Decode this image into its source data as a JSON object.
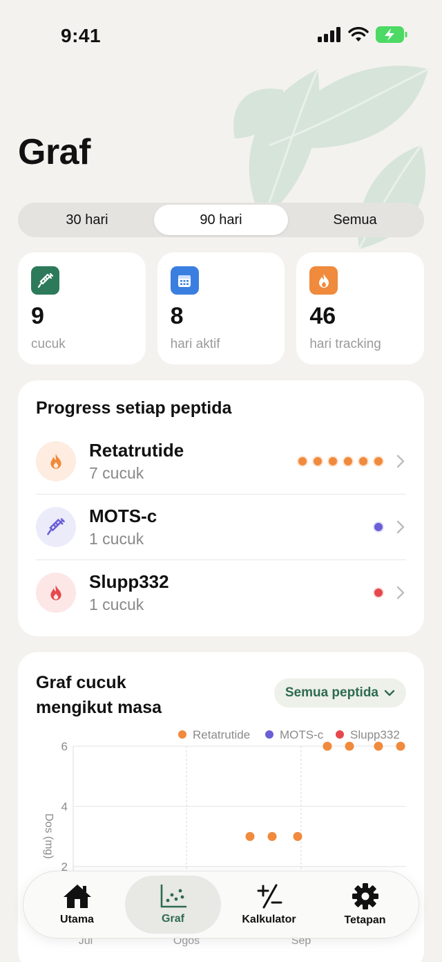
{
  "status_bar": {
    "time": "9:41"
  },
  "page": {
    "title": "Graf"
  },
  "range_tabs": [
    {
      "label": "30 hari",
      "active": false
    },
    {
      "label": "90 hari",
      "active": true
    },
    {
      "label": "Semua",
      "active": false
    }
  ],
  "stats": [
    {
      "value": "9",
      "label": "cucuk",
      "icon": "syringe-icon",
      "color": "#2d7a5a"
    },
    {
      "value": "8",
      "label": "hari aktif",
      "icon": "calendar-icon",
      "color": "#3a7fe0"
    },
    {
      "value": "46",
      "label": "hari tracking",
      "icon": "flame-icon",
      "color": "#f08a3c"
    }
  ],
  "progress": {
    "title": "Progress setiap peptida",
    "items": [
      {
        "name": "Retatrutide",
        "count": "7 cucuk",
        "icon": "flame-icon",
        "color": "#f08a3c",
        "avatar_bg": "#fdecdf",
        "dots": 6
      },
      {
        "name": "MOTS-c",
        "count": "1 cucuk",
        "icon": "syringe-icon",
        "color": "#6b5fd6",
        "avatar_bg": "#ecebfa",
        "dots": 1
      },
      {
        "name": "Slupp332",
        "count": "1 cucuk",
        "icon": "flame-icon",
        "color": "#e5484d",
        "avatar_bg": "#fde6e6",
        "dots": 1
      }
    ]
  },
  "chart_section": {
    "title": "Graf cucuk mengikut masa",
    "filter_label": "Semua peptida"
  },
  "chart_data": {
    "type": "scatter",
    "ylabel": "Dos (mg)",
    "xlabel": "",
    "y_ticks": [
      "6",
      "4",
      "2"
    ],
    "x_ticks": [
      "Jul",
      "Ogos",
      "Sep"
    ],
    "ylim": [
      2,
      6
    ],
    "legend_position": "top-right",
    "series": [
      {
        "name": "Retatrutide",
        "color": "#f08a3c",
        "points": [
          {
            "x": "Ogos ~18",
            "y": 3
          },
          {
            "x": "Ogos ~24",
            "y": 3
          },
          {
            "x": "Ogos ~31",
            "y": 3
          },
          {
            "x": "Sep ~7",
            "y": 6
          },
          {
            "x": "Sep ~13",
            "y": 6
          },
          {
            "x": "Sep ~21",
            "y": 6
          },
          {
            "x": "Sep ~27",
            "y": 6
          }
        ]
      },
      {
        "name": "MOTS-c",
        "color": "#6b5fd6",
        "points": []
      },
      {
        "name": "Slupp332",
        "color": "#e5484d",
        "points": []
      }
    ]
  },
  "tabbar": [
    {
      "label": "Utama",
      "icon": "home-icon",
      "active": false
    },
    {
      "label": "Graf",
      "icon": "scatter-chart-icon",
      "active": true
    },
    {
      "label": "Kalkulator",
      "icon": "plus-minus-icon",
      "active": false
    },
    {
      "label": "Tetapan",
      "icon": "gear-icon",
      "active": false
    }
  ]
}
